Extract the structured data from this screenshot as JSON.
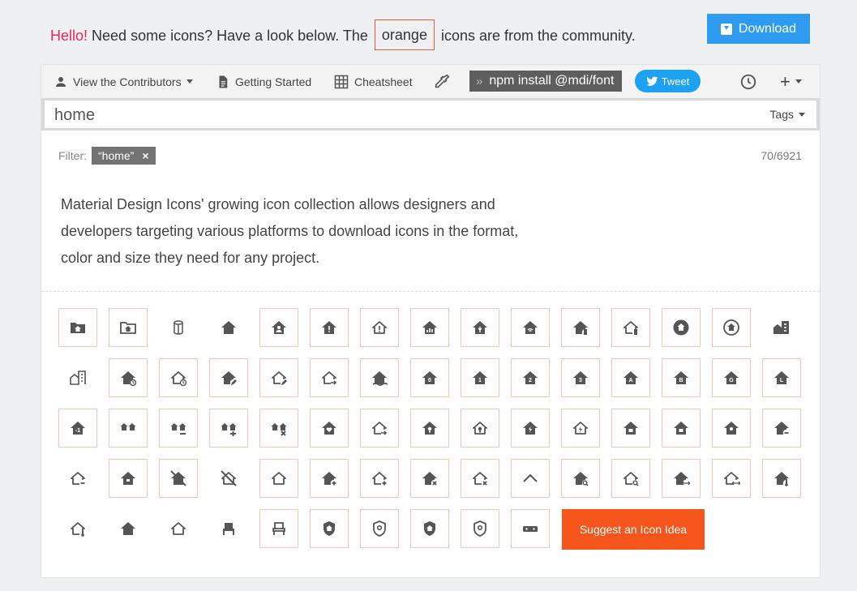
{
  "banner": {
    "hello": "Hello!",
    "text_before": " Need some icons? Have a look below. The ",
    "orange_word": "orange",
    "text_after": " icons are from the community.",
    "download_label": "Download"
  },
  "toolbar": {
    "contributors_label": "View the Contributors",
    "getting_started_label": "Getting Started",
    "cheatsheet_label": "Cheatsheet",
    "npm_chevron": "»",
    "npm_command": "npm install @mdi/font",
    "tweet_label": "Tweet",
    "plus_label": "+"
  },
  "search": {
    "value": "home",
    "tags_label": "Tags"
  },
  "filter": {
    "label": "Filter:",
    "chip": "“home”",
    "remove": "×",
    "count": "70/6921"
  },
  "description": "Material Design Icons' growing icon collection allows designers and developers targeting various platforms to download icons in the format, color and size they need for any project.",
  "icons": [
    "folder-home-icon",
    "folder-home-outline-icon",
    "home-floor-icon",
    "home-icon",
    "home-account-icon",
    "home-alert-icon",
    "home-alert-outline-icon",
    "home-analytics-icon",
    "home-assistant-icon",
    "home-automation-icon",
    "home-battery-icon",
    "home-battery-outline-icon",
    "home-circle-icon",
    "home-circle-outline-icon",
    "home-city-icon",
    "home-city-outline-icon",
    "home-clock-icon",
    "home-clock-outline-icon",
    "home-edit-icon",
    "home-edit-outline-icon",
    "home-export-outline-icon",
    "home-flood-icon",
    "home-floor-0-icon",
    "home-floor-1-icon",
    "home-floor-2-icon",
    "home-floor-3-icon",
    "home-floor-a-icon",
    "home-floor-b-icon",
    "home-floor-g-icon",
    "home-floor-l-icon",
    "home-floor-negative-1-icon",
    "home-group-icon",
    "home-group-minus-icon",
    "home-group-plus-icon",
    "home-group-remove-icon",
    "home-heart-icon",
    "home-import-outline-icon",
    "home-lightbulb-icon",
    "home-lightbulb-outline-icon",
    "home-lightning-bolt-icon",
    "home-lightning-bolt-outline-icon",
    "home-lock-icon",
    "home-lock-open-icon",
    "home-map-marker-icon",
    "home-minus-icon",
    "home-minus-outline-icon",
    "home-modern-icon",
    "home-off-icon",
    "home-off-outline-icon",
    "home-outline-icon",
    "home-plus-icon",
    "home-plus-outline-icon",
    "home-remove-icon",
    "home-remove-outline-icon",
    "home-roof-icon",
    "home-search-icon",
    "home-search-outline-icon",
    "home-switch-icon",
    "home-switch-outline-icon",
    "home-thermometer-icon",
    "home-thermometer-outline-icon",
    "home-variant-icon",
    "home-variant-outline-icon",
    "home-chair-icon",
    "home-chair-outline-icon",
    "shield-account-icon",
    "shield-account-outline-icon",
    "shield-home-icon",
    "shield-home-outline-icon",
    "home-sound-bar-icon"
  ],
  "suggest_label": "Suggest an Icon Idea",
  "colors": {
    "accent_blue": "#2d9cf0",
    "orange": "#f6561c",
    "hello_red": "#e32a5a",
    "icon_gray": "#555555",
    "community_border": "#f7c4b8"
  }
}
